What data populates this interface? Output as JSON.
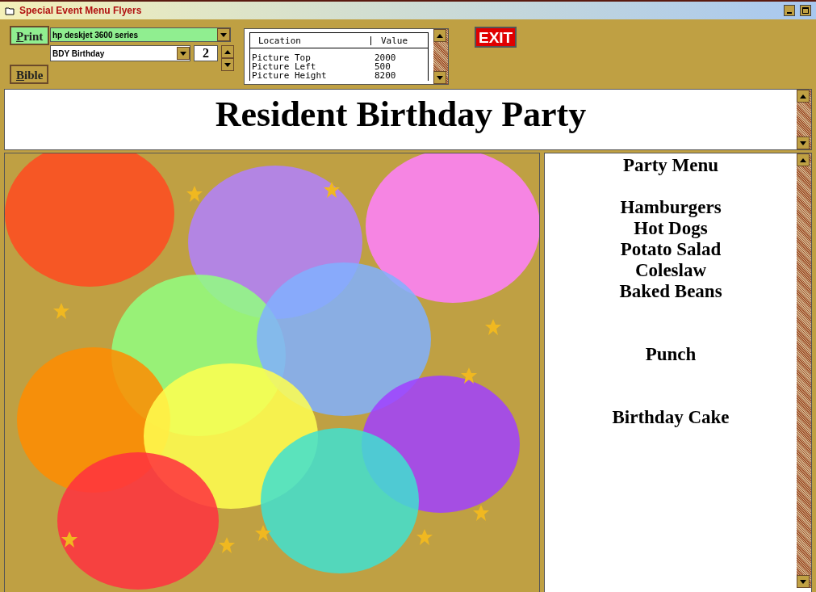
{
  "window": {
    "title": "Special Event Menu Flyers"
  },
  "toolbar": {
    "print_button": "Print",
    "bible_button": "Bible",
    "printer": "hp deskjet 3600 series",
    "template": "BDY Birthday",
    "copies": "2",
    "exit_button": "EXIT"
  },
  "properties": {
    "columns": [
      "Location",
      "Value"
    ],
    "rows": [
      [
        "Picture Top",
        "2000"
      ],
      [
        "Picture Left",
        "500"
      ],
      [
        "Picture Height",
        "8200"
      ]
    ]
  },
  "header": {
    "title": "Resident Birthday Party"
  },
  "menu": {
    "title": "Party Menu",
    "groups": [
      [
        "Hamburgers",
        "Hot Dogs",
        "Potato Salad",
        "Coleslaw",
        "Baked Beans"
      ],
      [
        "Punch"
      ],
      [
        "Birthday Cake"
      ]
    ]
  }
}
